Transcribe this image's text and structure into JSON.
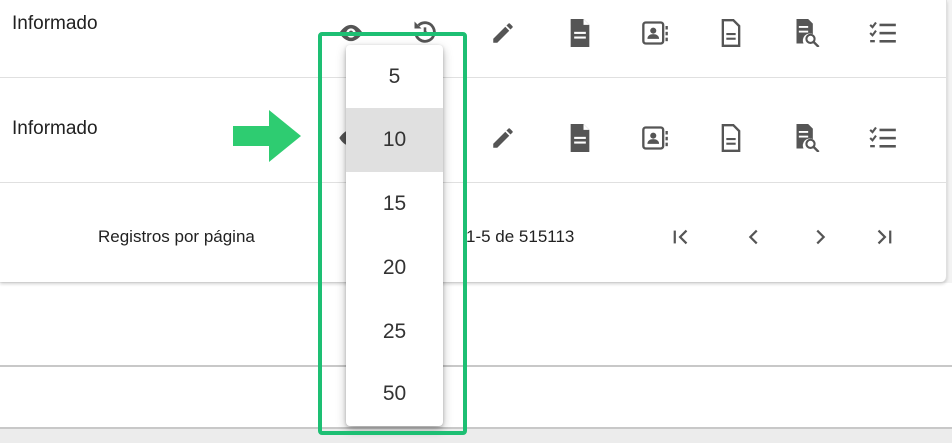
{
  "rows": [
    {
      "status": "Informado"
    },
    {
      "status": "Informado"
    }
  ],
  "row_icons": [
    "eye-icon",
    "history-icon",
    "pencil-icon",
    "document-icon",
    "contact-card-icon",
    "file-text-icon",
    "document-search-icon",
    "checklist-icon"
  ],
  "footer": {
    "rows_per_page_label": "Registros por página",
    "range_text": "1-5 de 515113"
  },
  "pager": [
    "first-page",
    "previous-page",
    "next-page",
    "last-page"
  ],
  "dropdown": {
    "options": [
      "5",
      "10",
      "15",
      "20",
      "25",
      "50"
    ],
    "selected": "10"
  },
  "colors": {
    "highlight": "#1dbf73",
    "arrow": "#2ecc71",
    "icon": "#555555",
    "selected_option_bg": "#e0e0e0"
  }
}
